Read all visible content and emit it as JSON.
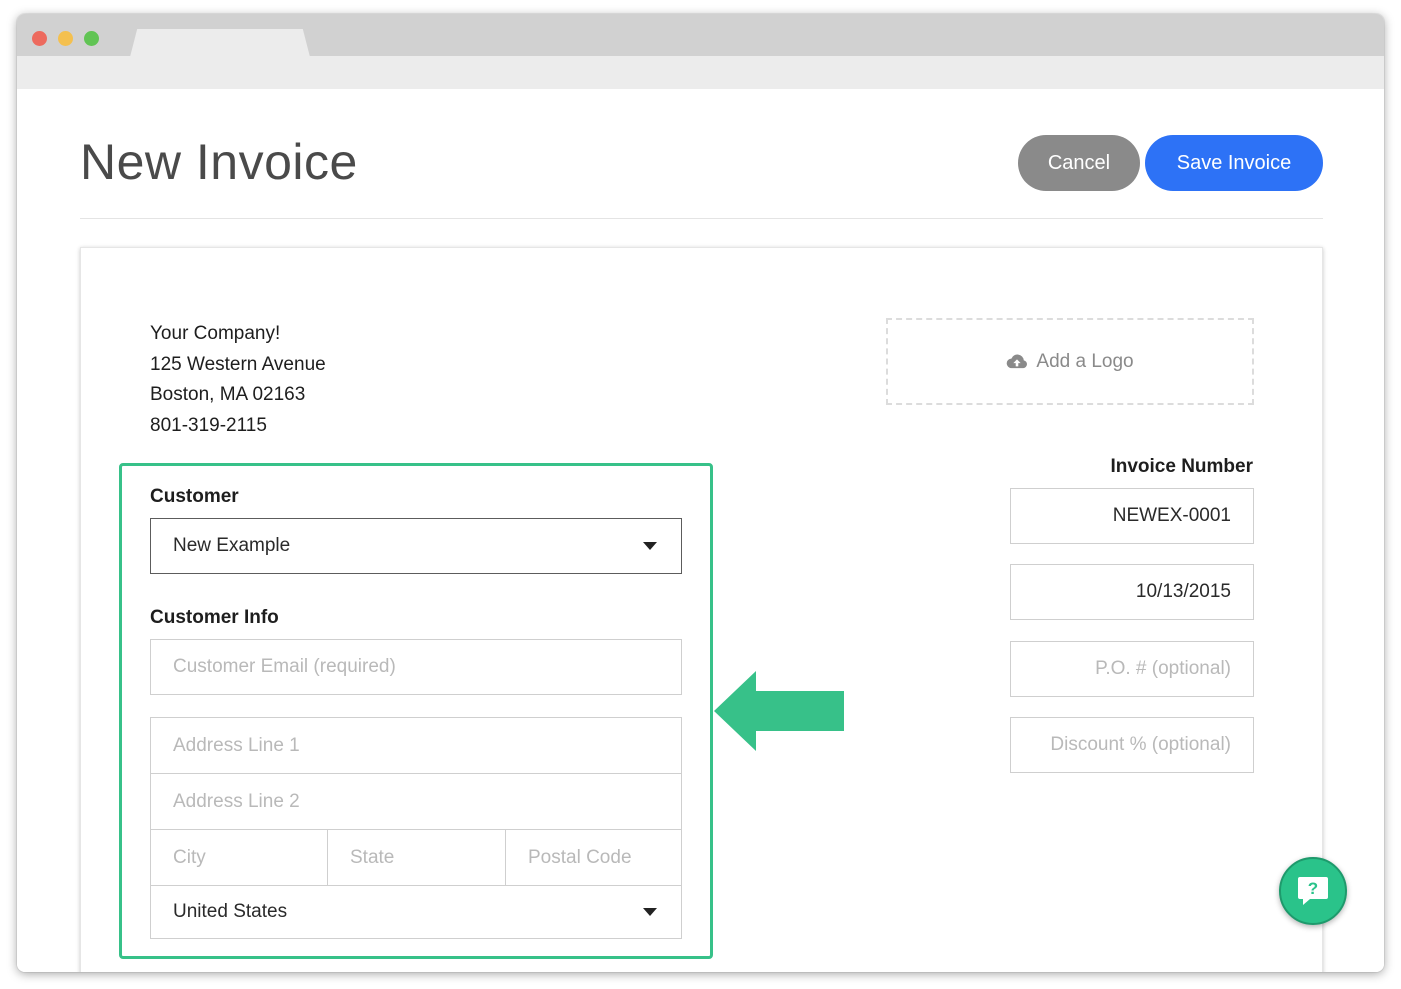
{
  "page": {
    "title": "New Invoice"
  },
  "actions": {
    "cancel_label": "Cancel",
    "save_label": "Save Invoice"
  },
  "company": {
    "name": "Your Company!",
    "street": "125 Western Avenue",
    "city_line": "Boston, MA 02163",
    "phone": "801-319-2115"
  },
  "logo": {
    "label": "Add a Logo",
    "icon": "cloud-upload-icon"
  },
  "customer": {
    "label": "Customer",
    "selected": "New Example"
  },
  "customer_info": {
    "label": "Customer Info",
    "email_placeholder": "Customer Email (required)",
    "address1_placeholder": "Address Line 1",
    "address2_placeholder": "Address Line 2",
    "city_placeholder": "City",
    "state_placeholder": "State",
    "postal_placeholder": "Postal Code",
    "country": "United States"
  },
  "invoice": {
    "number_label": "Invoice Number",
    "number_value": "NEWEX-0001",
    "date_value": "10/13/2015",
    "po_placeholder": "P.O. # (optional)",
    "discount_placeholder": "Discount % (optional)"
  },
  "help": {
    "icon": "help-chat-icon",
    "glyph": "?"
  },
  "colors": {
    "primary": "#2d72f6",
    "cancel": "#8a8a8a",
    "accent": "#37c189"
  }
}
